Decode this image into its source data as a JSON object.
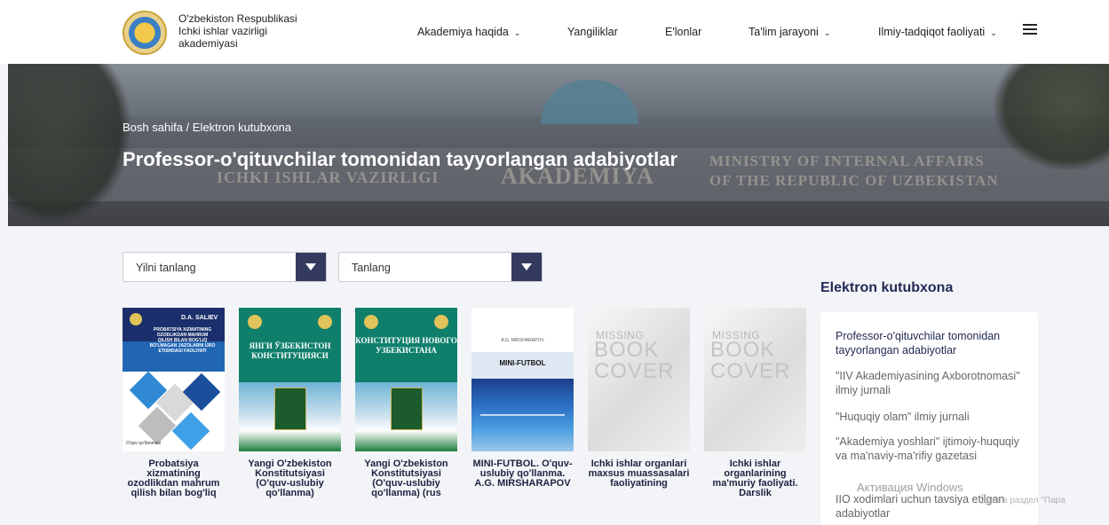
{
  "header": {
    "logo_text": "O'zbekiston Respublikasi Ichki ishlar vazirligi akademiyasi",
    "nav": [
      {
        "label": "Akademiya haqida",
        "has_dropdown": true
      },
      {
        "label": "Yangiliklar",
        "has_dropdown": false
      },
      {
        "label": "E'lonlar",
        "has_dropdown": false
      },
      {
        "label": "Ta'lim jarayoni",
        "has_dropdown": true
      },
      {
        "label": "Ilmiy-tadqiqot faoliyati",
        "has_dropdown": true
      }
    ],
    "dropdown_glyph": "⌄",
    "menu_icon": "hamburger-icon"
  },
  "hero": {
    "breadcrumb": "Bosh sahifa / Elektron kutubxona",
    "title": "Professor-o'qituvchilar tomonidan tayyorlangan adabiyotlar",
    "building_text": {
      "line1": "ICHKI ISHLAR VAZIRLIGI",
      "word2": "AKADEMIYA",
      "right1": "MINISTRY OF INTERNAL AFFAIRS",
      "right2": "OF THE REPUBLIC OF UZBEKISTAN"
    }
  },
  "filters": {
    "year_select": "Yilni tanlang",
    "type_select": "Tanlang"
  },
  "books": [
    {
      "title": "Probatsiya xizmatining ozodlikdan mahrum qilish bilan bog'liq",
      "cover_author": "D.A. SALIEV",
      "cover_text": "PROBATSIYA XIZMATINING OZODLIKDAN MAHRUM QILISH BILAN BOG'LIQ BO'LMAGAN JAZOLARNI IJRO ETISHDAGI FAOLIYATI",
      "cover_footer": "O'quv qo'llanmasi"
    },
    {
      "title": "Yangi O'zbekiston Konstitutsiyasi (O'quv-uslubiy qo'llanma)",
      "cover_text": "ЯНГИ ЎЗБЕКИСТОН КОНСТИТУЦИЯСИ"
    },
    {
      "title": "Yangi O'zbekiston Konstitutsiyasi (O'quv-uslubiy qo'llanma) (rus",
      "cover_text": "КОНСТИТУЦИЯ НОВОГО УЗБЕКИСТАНА"
    },
    {
      "title": "MINI-FUTBOL. O'quv-uslubiy qo'llanma. A.G. MIRSHARAPOV",
      "cover_author": "A.G. MIRSHARAPOV",
      "cover_text": "MINI-FUTBOL"
    },
    {
      "title": "Ichki ishlar organlari maxsus muassasalari faoliyatining",
      "cover_missing": "MISSING",
      "cover_book": "BOOK COVER"
    },
    {
      "title": "Ichki ishlar organlarining ma'muriy faoliyati. Darslik",
      "cover_missing": "MISSING",
      "cover_book": "BOOK COVER"
    }
  ],
  "sidebar": {
    "title": "Elektron kutubxona",
    "items": [
      "Professor-o'qituvchilar tomonidan tayyorlangan adabiyotlar",
      "\"IIV Akademiyasining Axborotnomasi\" ilmiy jurnali",
      "\"Huquqiy olam\" ilmiy jurnali",
      "\"Akademiya yoshlari\" ijtimoiy-huquqiy va ma'naviy-ma'rifiy gazetasi",
      "IIO xodimlari uchun tavsiya etilgan adabiyotlar"
    ]
  },
  "watermark": {
    "line1": "Активация Windows",
    "line2": "дите в раздел \"Пара"
  },
  "colors": {
    "accent": "#343a5e",
    "sidebar_title": "#222a55",
    "book_title": "#1e2240"
  }
}
